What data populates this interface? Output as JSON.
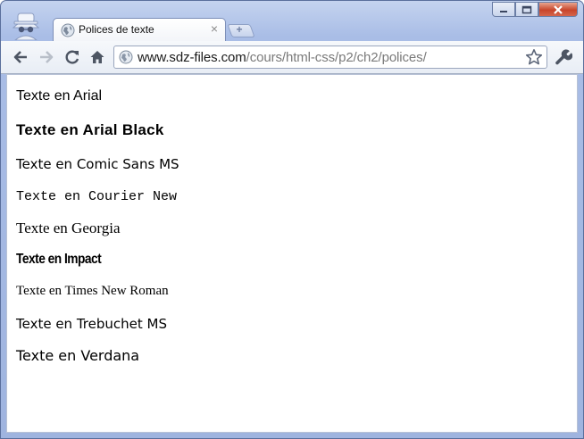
{
  "browser": {
    "tab": {
      "title": "Polices de texte",
      "close_glyph": "×"
    },
    "new_tab_glyph": "+",
    "address": {
      "host": "www.sdz-files.com",
      "path": "/cours/html-css/p2/ch2/polices/"
    },
    "icons": {
      "incognito": "incognito-icon",
      "favicon": "globe-icon",
      "back": "back-arrow-icon",
      "forward": "forward-arrow-icon",
      "reload": "reload-icon",
      "home": "home-icon",
      "bookmark": "star-icon",
      "menu": "wrench-icon",
      "minimize": "minimize-icon",
      "maximize": "maximize-icon",
      "close": "close-icon"
    },
    "colors": {
      "frame": "#a9bde6",
      "close_button": "#c8452b"
    }
  },
  "page": {
    "lines": [
      "Texte en Arial",
      "Texte en Arial Black",
      "Texte en Comic Sans MS",
      "Texte en Courier New",
      "Texte en Georgia",
      "Texte en Impact",
      "Texte en Times New Roman",
      "Texte en Trebuchet MS",
      "Texte en Verdana"
    ]
  }
}
